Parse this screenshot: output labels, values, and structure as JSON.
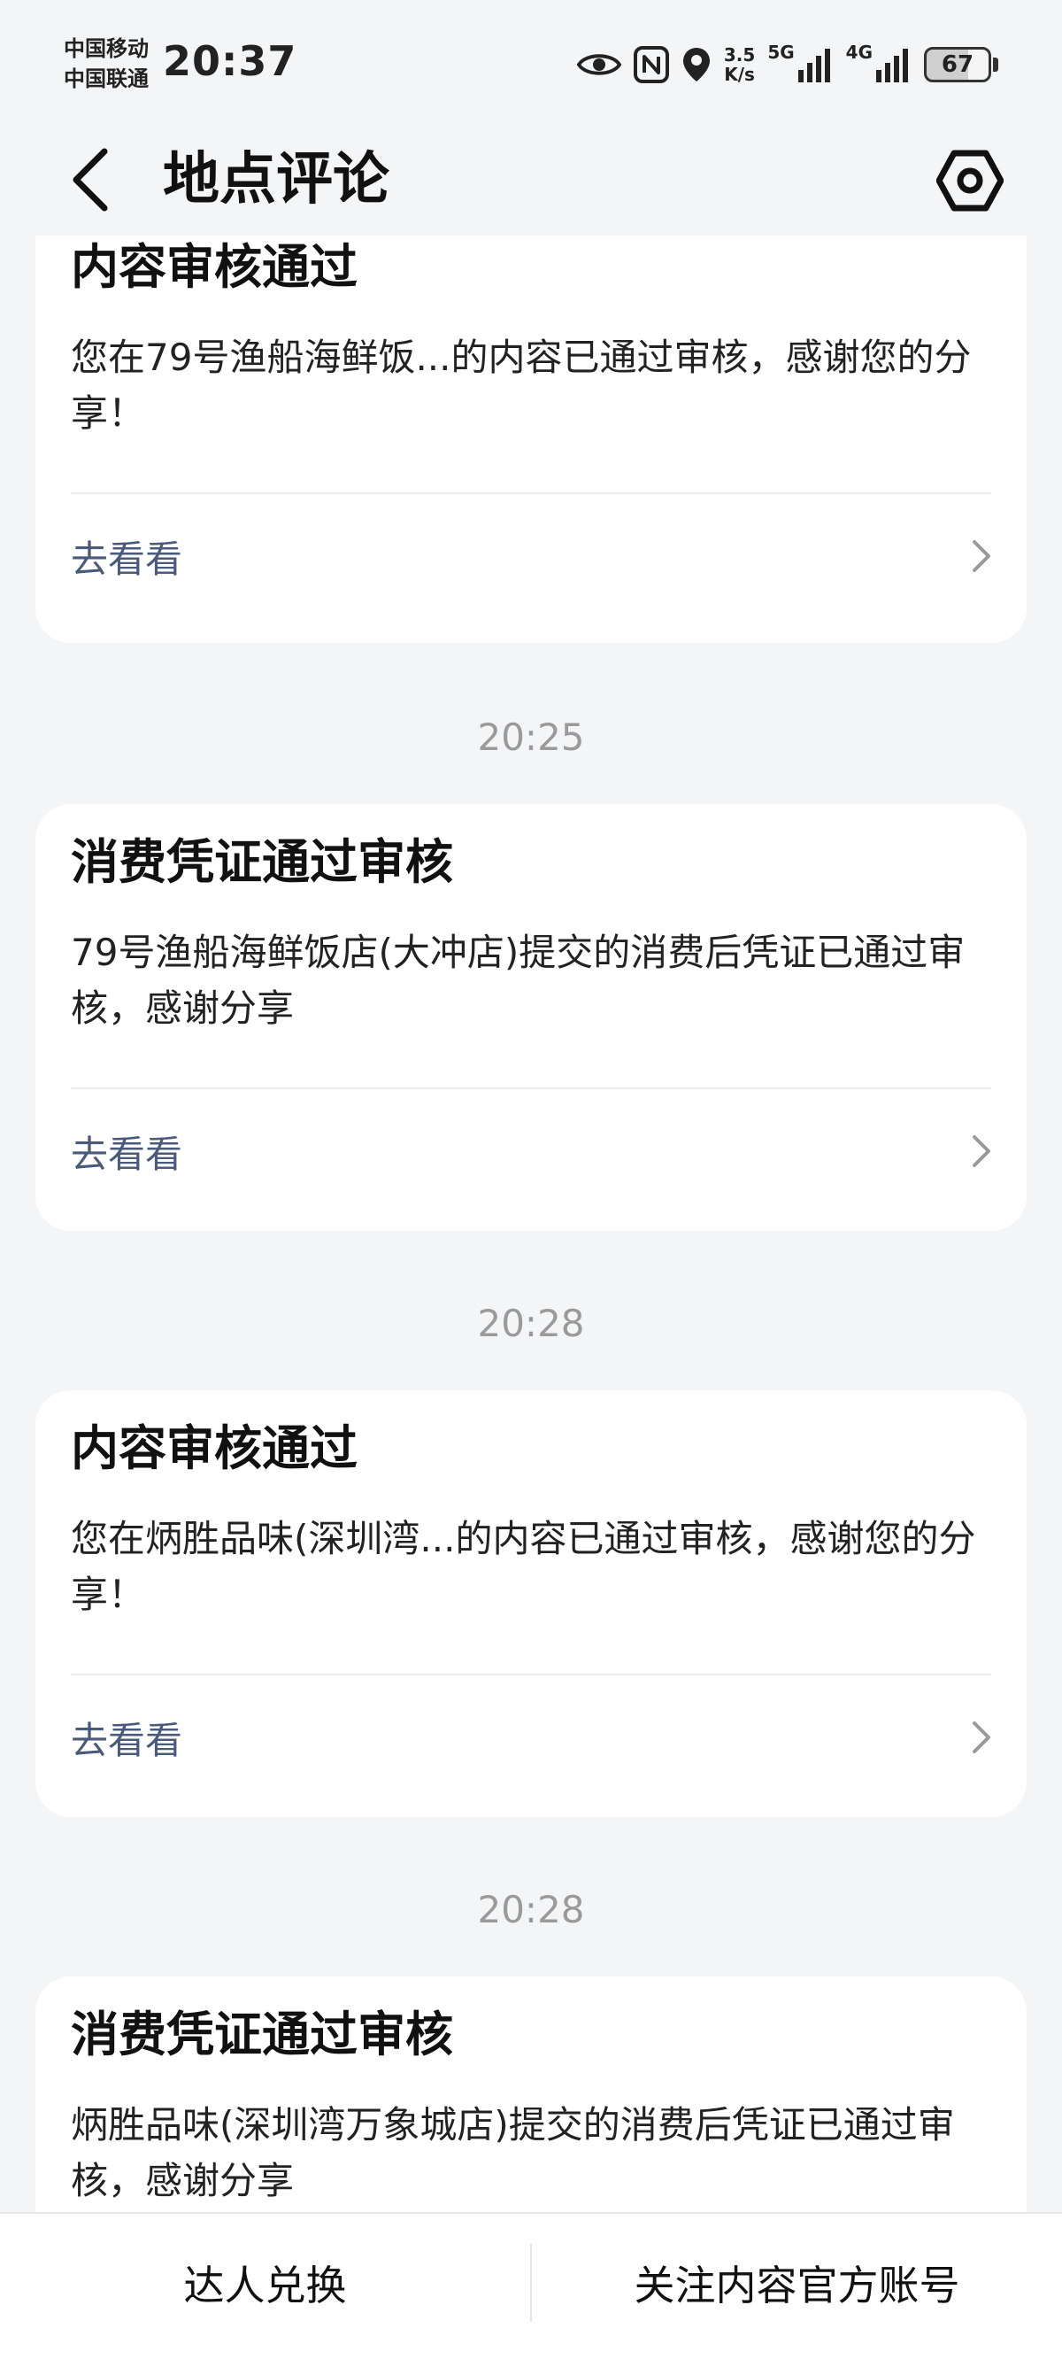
{
  "status_bar": {
    "carrier_1": "中国移动",
    "carrier_2": "中国联通",
    "time": "20:37",
    "net_speed_value": "3.5",
    "net_speed_unit": "K/s",
    "signal_1_label": "5G",
    "signal_2_label": "4G",
    "battery": "67",
    "icons": [
      "eye-icon",
      "nfc-icon",
      "location-icon",
      "signal-icon",
      "battery-icon"
    ]
  },
  "header": {
    "title": "地点评论",
    "back_icon": "chevron-left-icon",
    "settings_icon": "hexagon-settings-icon"
  },
  "messages": [
    {
      "title": "内容审核通过",
      "body": "您在79号渔船海鲜饭...的内容已通过审核，感谢您的分享！",
      "action": "去看看"
    },
    {
      "time": "20:25",
      "title": "消费凭证通过审核",
      "body": "79号渔船海鲜饭店(大冲店)提交的消费后凭证已通过审核，感谢分享",
      "action": "去看看"
    },
    {
      "time": "20:28",
      "title": "内容审核通过",
      "body": "您在炳胜品味(深圳湾...的内容已通过审核，感谢您的分享！",
      "action": "去看看"
    },
    {
      "time": "20:28",
      "title": "消费凭证通过审核",
      "body": "炳胜品味(深圳湾万象城店)提交的消费后凭证已通过审核，感谢分享"
    }
  ],
  "bottom_bar": {
    "left_label": "达人兑换",
    "right_label": "关注内容官方账号"
  },
  "colors": {
    "background": "#f4f5f7",
    "card": "#ffffff",
    "link": "#4a5a7a",
    "timestamp": "#9a9a9a"
  }
}
